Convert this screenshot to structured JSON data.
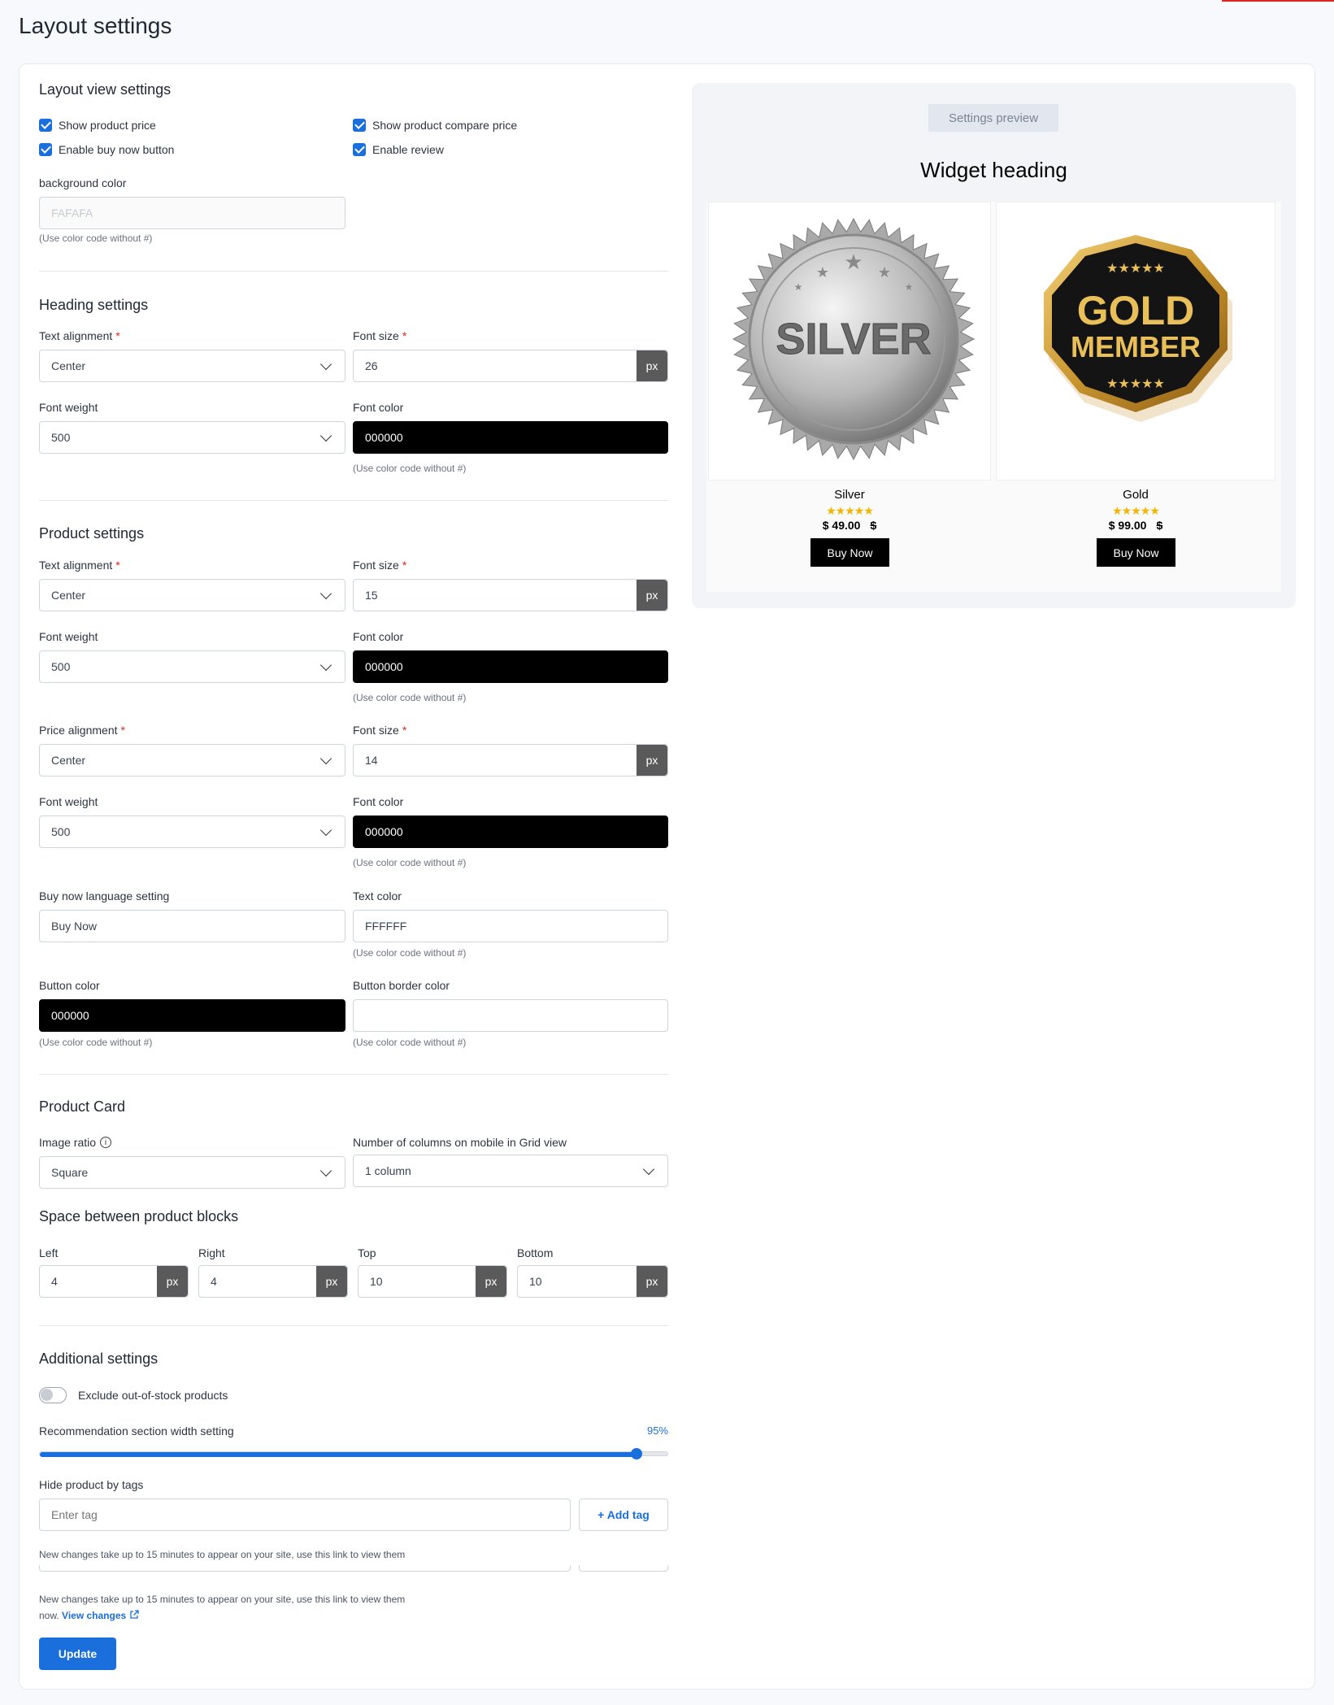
{
  "page_title": "Layout settings",
  "layout_view": {
    "title": "Layout view settings",
    "checks": [
      "Show product price",
      "Show product compare price",
      "Enable buy now button",
      "Enable review"
    ],
    "bg_label": "background color",
    "bg_value": "FAFAFA",
    "hint": "(Use color code without #)"
  },
  "heading": {
    "title": "Heading settings",
    "text_align_label": "Text alignment",
    "text_align": "Center",
    "font_size_label": "Font size",
    "font_size": "26",
    "font_weight_label": "Font weight",
    "font_weight": "500",
    "font_color_label": "Font color",
    "font_color": "000000",
    "hint": "(Use color code without #)",
    "unit": "px"
  },
  "product": {
    "title": "Product settings",
    "text_align_label": "Text alignment",
    "text_align": "Center",
    "font_size_label": "Font size",
    "font_size": "15",
    "font_weight_label": "Font weight",
    "font_weight": "500",
    "font_color_label": "Font color",
    "font_color": "000000",
    "price_align_label": "Price alignment",
    "price_align": "Center",
    "price_font_size_label": "Font size",
    "price_font_size": "14",
    "price_font_weight_label": "Font weight",
    "price_font_weight": "500",
    "price_font_color_label": "Font color",
    "price_font_color": "000000",
    "buy_lang_label": "Buy now language setting",
    "buy_lang": "Buy Now",
    "text_color_label": "Text color",
    "text_color": "FFFFFF",
    "button_color_label": "Button color",
    "button_color": "000000",
    "button_border_label": "Button border color",
    "button_border": "",
    "hint": "(Use color code without #)",
    "unit": "px"
  },
  "product_card": {
    "title": "Product Card",
    "ratio_label": "Image ratio",
    "ratio": "Square",
    "columns_label": "Number of columns on mobile in Grid view",
    "columns": "1 column",
    "space_title": "Space between product blocks",
    "left_label": "Left",
    "left": "4",
    "right_label": "Right",
    "right": "4",
    "top_label": "Top",
    "top": "10",
    "bottom_label": "Bottom",
    "bottom": "10",
    "unit": "px"
  },
  "additional": {
    "title": "Additional settings",
    "exclude_label": "Exclude out-of-stock products",
    "exclude_on": false,
    "width_label": "Recommendation section width setting",
    "width_value": "95%",
    "width_fraction": 0.95,
    "tags_label": "Hide product by tags",
    "tags_placeholder": "Enter tag",
    "add_tag": "+ Add tag",
    "notice_overlay": "New changes take up to 15 minutes to appear on your site, use this link to view them",
    "notice_line1": "New changes take up to 15 minutes to appear on your site, use this link to view them",
    "notice_now": "now.",
    "view_changes": "View changes",
    "update": "Update"
  },
  "preview": {
    "badge": "Settings preview",
    "heading": "Widget heading",
    "products": [
      {
        "name": "Silver",
        "stars": "★★★★★",
        "price": "$ 49.00",
        "compare": "$",
        "button": "Buy Now",
        "badge_text": "SILVER"
      },
      {
        "name": "Gold",
        "stars": "★★★★★",
        "price": "$ 99.00",
        "compare": "$",
        "button": "Buy Now",
        "badge_text_1": "GOLD",
        "badge_text_2": "MEMBER"
      }
    ]
  },
  "colors": {
    "accent": "#1a6fdc",
    "required": "#e0251f",
    "star": "#f4b400"
  }
}
